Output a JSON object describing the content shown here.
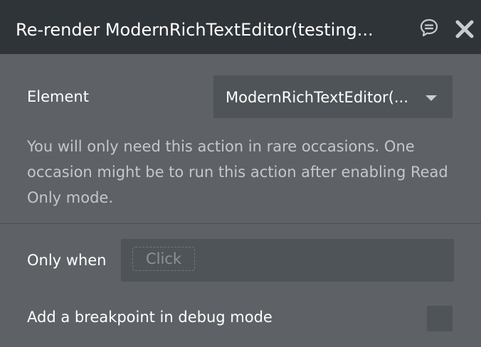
{
  "header": {
    "title": "Re-render ModernRichTextEditor(testing...",
    "comment_icon": "comment-icon",
    "close_icon": "close-icon"
  },
  "element_field": {
    "label": "Element",
    "value": "ModernRichTextEditor(...",
    "caret_icon": "chevron-down-icon"
  },
  "description": "You will only need this action in rare occasions. One occasion might be to run this action after enabling Read Only mode.",
  "only_when": {
    "label": "Only when",
    "placeholder": "Click"
  },
  "breakpoint": {
    "label": "Add a breakpoint in debug mode",
    "checked": false
  },
  "colors": {
    "header_bg": "#2f3438",
    "panel_bg": "#5e6266",
    "field_bg": "#4f5458",
    "text": "#ffffff",
    "muted_text": "#c4c7ca"
  }
}
